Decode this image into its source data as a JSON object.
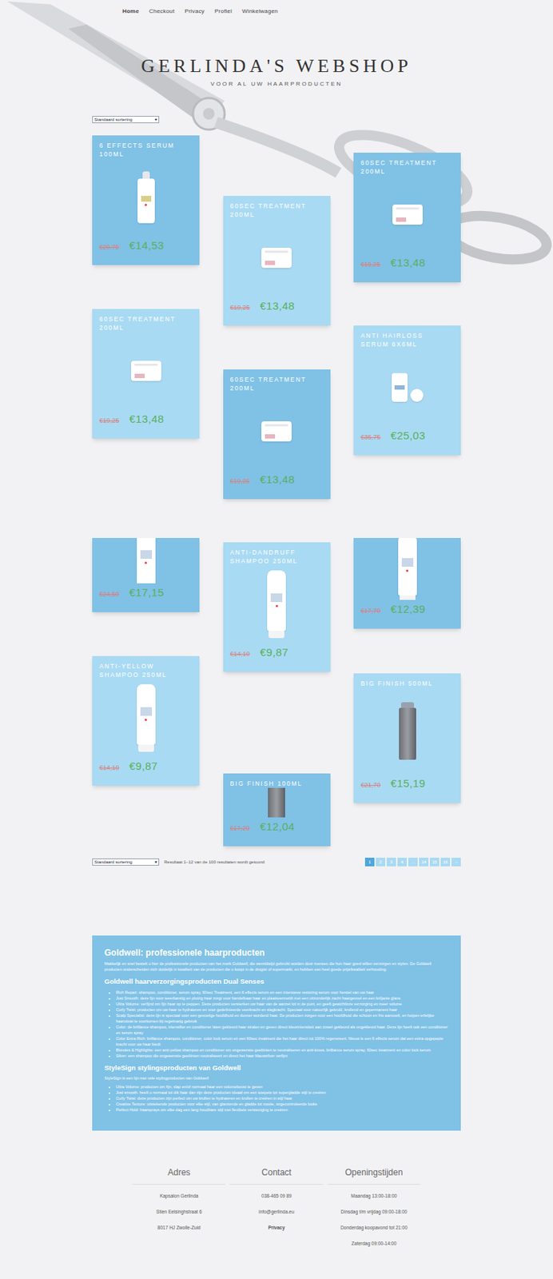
{
  "nav": [
    {
      "label": "Home",
      "selected": true
    },
    {
      "label": "Checkout",
      "selected": false
    },
    {
      "label": "Privacy",
      "selected": false
    },
    {
      "label": "Profiel",
      "selected": false
    },
    {
      "label": "Winkelwagen",
      "selected": false
    }
  ],
  "header": {
    "title": "GERLINDA'S WEBSHOP",
    "subtitle": "VOOR AL UW HAARPRODUCTEN"
  },
  "sort": {
    "value": "Standaard sortering",
    "arrow": "▾"
  },
  "products": [
    {
      "title": "6 EFFECTS SERUM 100ML",
      "old_price": "€20,75",
      "price": "€14,53",
      "kind": "pump"
    },
    {
      "title": "60SEC TREATMENT 200ML",
      "old_price": "€19,25",
      "price": "€13,48",
      "kind": "jar"
    },
    {
      "title": "60SEC TREATMENT 200ML",
      "old_price": "€19,25",
      "price": "€13,48",
      "kind": "jar"
    },
    {
      "title": "60SEC TREATMENT 200ML",
      "old_price": "€19,25",
      "price": "€13,48",
      "kind": "jar"
    },
    {
      "title": "60SEC TREATMENT 200ML",
      "old_price": "€19,25",
      "price": "€13,48",
      "kind": "jar"
    },
    {
      "title": "ANTI HAIRLOSS SERUM 6X6ML",
      "old_price": "€35,75",
      "price": "€25,03",
      "kind": "vial"
    },
    {
      "title": "",
      "old_price": "€24,50",
      "price": "€17,15",
      "kind": "bottle"
    },
    {
      "title": "ANTI-DANDRUFF SHAMPOO 250ML",
      "old_price": "€14,10",
      "price": "€9,87",
      "kind": "bottle"
    },
    {
      "title": "",
      "old_price": "€17,70",
      "price": "€12,39",
      "kind": "bottle"
    },
    {
      "title": "ANTI-YELLOW SHAMPOO 250ML",
      "old_price": "€14,10",
      "price": "€9,87",
      "kind": "bottle"
    },
    {
      "title": "BIG FINISH 100ML",
      "old_price": "€17,20",
      "price": "€12,04",
      "kind": "can"
    },
    {
      "title": "BIG FINISH 500ML",
      "old_price": "€21,70",
      "price": "€15,19",
      "kind": "can"
    }
  ],
  "pagination": {
    "sort_value": "Standaard sortering",
    "sort_arrow": "▾",
    "result_text": "Resultaat 1–12 van de 100 resultaten wordt getoond",
    "pages": [
      {
        "label": "1",
        "selected": true
      },
      {
        "label": "2",
        "selected": false
      },
      {
        "label": "3",
        "selected": false
      },
      {
        "label": "4",
        "selected": false
      },
      {
        "label": "…",
        "selected": false
      },
      {
        "label": "14",
        "selected": false
      },
      {
        "label": "15",
        "selected": false
      },
      {
        "label": "16",
        "selected": false
      },
      {
        "label": "→",
        "selected": false
      }
    ]
  },
  "info": {
    "sections": [
      {
        "heading": "Goldwell: professionele haarproducten",
        "paragraph": "Makkelijk en snel bestelt u hier de professionele producten van het merk Goldwell, die wereldwijd gebruikt worden door mensen die hun haar goed willen verzorgen en stylen. De Goldwell producten onderscheiden zich duidelijk in kwaliteit van de producten die u koopt in de drogist of supermarkt, en hebben een heel goede prijs/kwaliteit verhouding.",
        "bullets": []
      },
      {
        "heading": "Goldwell haarverzorgingsproducten Dual Senses",
        "paragraph": "",
        "bullets": [
          "Rich Repair: shampoo, conditioner, serum spray, 60sec Treatment, een 6 effects serum en een intensieve restoring serum voor herstel van uw haar",
          "Just Smooth: deze lijn voor weerbarstig en pluizig haar zorgt voor handelbaar haar en plaatsvermeldt met een uitzonderlijk zacht haargevoel en een briljante glans",
          "Ultra Volume: verfijnd om fijn haar op te peppen. Deze producten versterken uw haar van de aanzet tot in de punt, en geeft gewichtloze verzorging en meer volume",
          "Curly Twist: producten om uw haar te hydrateren en voor gedefinieerde veerkracht en slagkracht. Speciaal voor natuurlijk gekruld, krullend en gepermanent haar",
          "Scalp Specialist: deze lijn is speciaal voor een gevoelige hoofdhuid en dunner wordend haar. De producten zorgen voor een hoofdhuid die schoon en fris aanvoelt, en helpen erfelijke haaruitval te voorkomen bij regelmatig gebruik",
          "Color: de brilliance shampoo, intensifier en conditioner laten gekleurd haar stralen en geven direct kleurintensiteit aan zowel gekleurd als ongekleurd haar. Deze lijn heeft ook een conditioner en serum spray",
          "Color Extra Rich: brilliance shampoo, conditioner, color lock serum en een 60sec treatment die het haar direct tot 100% regenereert. Nieuw is een 6 effects serum dat een extra opgepepte kracht voor uw haar biedt",
          "Blondes & Highlights: een anti-yellow shampoo en conditioner om ongewenste geeltinten te neutraliseren en anti-kroes, brilliance serum spray, 60sec treatment en color lock serum",
          "Silver: een shampoo die ongewenste geeltinten neutraliseert en direct het haar blauwzilver verfijnt"
        ]
      },
      {
        "heading": "StyleSign stylingsproducten van Goldwell",
        "paragraph": "StyleSign is een lijn met vele stylingproducten van Goldwell",
        "bullets": [
          "Ultra Volume: producten om fijn, slap en/of normaal haar een volumeboost te geven",
          "Just smooth: heeft u normaal tot dik haar dan zijn deze producten ideaal om een soepele tot supergladde stijl te creëren",
          "Curly Twist: deze producten zijn perfect om uw krullen te hydrateren en krullen te creëren in stijl haar",
          "Creative Texture: uitstekende producten voor elke stijl, van glanzende en gladde tot mooie, ongecontroleerde looks",
          "Perfect Hold: haarsprays om elke dag een lang houdbare stijl met flexibele versteviging te creëren"
        ]
      }
    ]
  },
  "footer": {
    "columns": [
      {
        "heading": "Adres",
        "lines": [
          {
            "text": "Kapsalon Gerlinda",
            "bold": false
          },
          {
            "text": "Stien Eelsinghstraat 6",
            "bold": false
          },
          {
            "text": "8017 HJ Zwolle-Zuid",
            "bold": false
          }
        ]
      },
      {
        "heading": "Contact",
        "lines": [
          {
            "text": "038-465 09 89",
            "bold": false
          },
          {
            "text": "info@gerlinda.eu",
            "bold": false
          },
          {
            "text": "Privacy",
            "bold": true
          }
        ]
      },
      {
        "heading": "Openingstijden",
        "lines": [
          {
            "text": "Maandag 13:00-18:00",
            "bold": false
          },
          {
            "text": "Dinsdag t/m vrijdag 09:00-18:00",
            "bold": false
          },
          {
            "text": "Donderdag koopavond tot 21:00",
            "bold": false
          },
          {
            "text": "Zaterdag 09:00-14:00",
            "bold": false
          }
        ]
      }
    ]
  }
}
